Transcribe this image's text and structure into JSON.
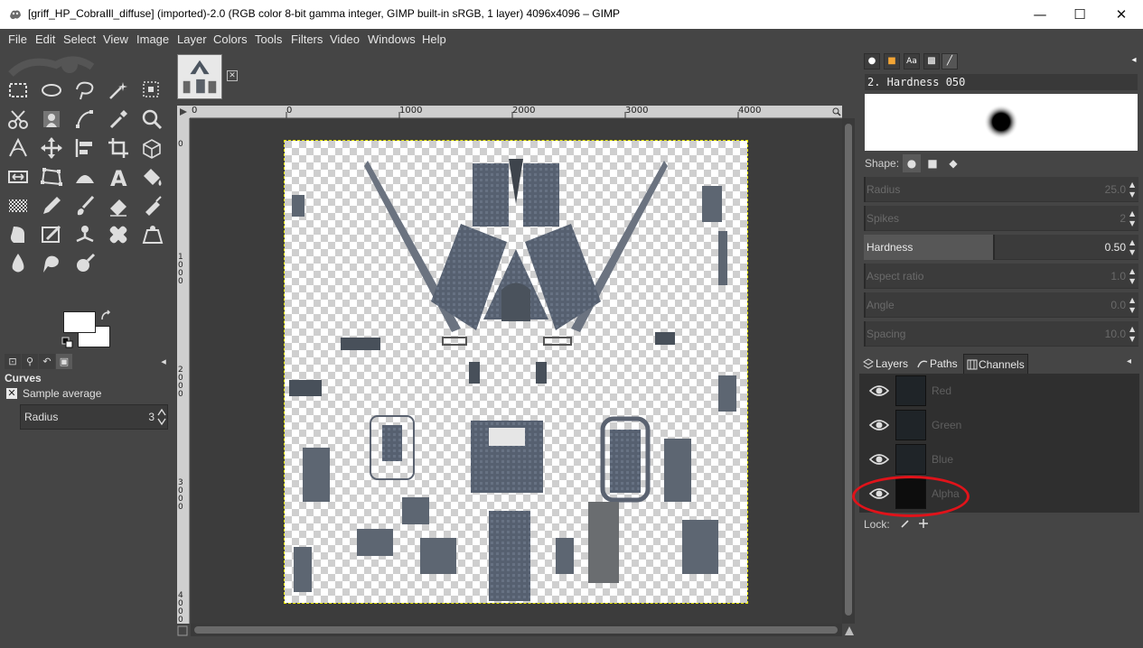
{
  "window": {
    "title": "[griff_HP_CobraIll_diffuse] (imported)-2.0 (RGB color 8-bit gamma integer, GIMP built-in sRGB, 1 layer) 4096x4096 – GIMP",
    "minimize": "—",
    "maximize": "☐",
    "close": "✕"
  },
  "menu": [
    "File",
    "Edit",
    "Select",
    "View",
    "Image",
    "Layer",
    "Colors",
    "Tools",
    "Filters",
    "Video",
    "Windows",
    "Help"
  ],
  "toolbox": {
    "tools": [
      "rect-select",
      "ellipse-select",
      "free-select",
      "fuzzy-select",
      "select-by-color",
      "scissors-select",
      "foreground-select",
      "paths",
      "color-picker",
      "zoom",
      "measure",
      "move",
      "align",
      "crop",
      "unified-transform",
      "transform",
      "perspective",
      "flip",
      "text",
      "bucket-fill",
      "blend",
      "pencil",
      "paintbrush",
      "eraser",
      "airbrush",
      "ink",
      "mypaint-brush",
      "clone",
      "heal",
      "perspective-clone",
      "blur",
      "smudge",
      "dodge-burn"
    ],
    "fg_color": "#ffffff",
    "bg_color": "#ffffff"
  },
  "tool_options": {
    "title": "Curves",
    "sample_average_label": "Sample average",
    "radius_label": "Radius",
    "radius_value": "3"
  },
  "canvas": {
    "ruler_top_labels": [
      "0",
      "0",
      "1000",
      "2000",
      "3000",
      "4000"
    ],
    "ruler_left_labels": [
      "0",
      "1000",
      "2000",
      "3000",
      "4000"
    ]
  },
  "brushes": {
    "selected_name": "2. Hardness 050",
    "shape_label": "Shape:",
    "sliders": [
      {
        "label": "Radius",
        "value": "25.0",
        "fill": 0.0,
        "active": false
      },
      {
        "label": "Spikes",
        "value": "2",
        "fill": 0.0,
        "active": false
      },
      {
        "label": "Hardness",
        "value": "0.50",
        "fill": 0.5,
        "active": true
      },
      {
        "label": "Aspect ratio",
        "value": "1.0",
        "fill": 0.0,
        "active": false
      },
      {
        "label": "Angle",
        "value": "0.0",
        "fill": 0.0,
        "active": false
      },
      {
        "label": "Spacing",
        "value": "10.0",
        "fill": 0.0,
        "active": false
      }
    ]
  },
  "layers_panel": {
    "tabs": [
      "Layers",
      "Paths",
      "Channels"
    ],
    "active_tab": "Channels",
    "channels": [
      "Red",
      "Green",
      "Blue",
      "Alpha"
    ],
    "lock_label": "Lock:"
  },
  "colors": {
    "highlight": "#e0131a",
    "selection": "#e6e600"
  }
}
